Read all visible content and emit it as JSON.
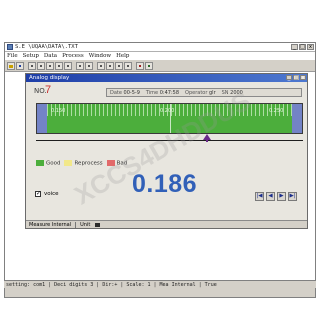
{
  "window": {
    "title": "S.E \\UQAA\\DATA\\.TXT",
    "menus": [
      "File",
      "Setup",
      "Data",
      "Process",
      "Window",
      "Help"
    ]
  },
  "analog": {
    "title": "Analog display",
    "no_label": "NO.",
    "no_value": "7",
    "info": {
      "date_label": "Date",
      "date_value": "00-5-9",
      "time_label": "Time",
      "time_value": "0:47:58",
      "operator_label": "Operator",
      "operator_value": "glr",
      "sn_label": "SN",
      "sn_value": "2000"
    },
    "gauge": {
      "tick_left": "0.150",
      "tick_center": "0.200",
      "tick_right": "0.250",
      "zone_color": "#7383c6",
      "good_color": "#4cae3c"
    },
    "pointer_fraction": 0.64,
    "legend": [
      {
        "label": "Good",
        "color": "#4cae3c"
      },
      {
        "label": "Reprocess",
        "color": "#f2e88a"
      },
      {
        "label": "Bad",
        "color": "#e26a6a"
      }
    ],
    "big_value": "0.186",
    "voice_label": "voice",
    "bottom_measure": "Measure Internal",
    "bottom_unit": "Unit",
    "nav": [
      "first",
      "prev",
      "next",
      "last"
    ]
  },
  "statusbar": {
    "text": "setting: com1 | Deci digits 3 | Dir:+ | Scale: 1 | Mea Internal | True"
  },
  "watermark": "XCCS4DHDDUS"
}
